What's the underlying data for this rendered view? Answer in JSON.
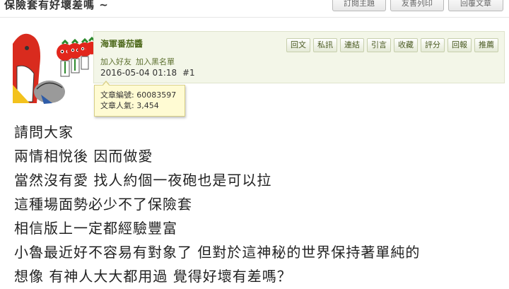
{
  "topic": {
    "title": "保險套有好壞差嗎 ~"
  },
  "toolbar": {
    "subscribe": "訂閱主題",
    "print": "友善列印",
    "reply": "回覆文章"
  },
  "post": {
    "author": "海軍番茄醬",
    "add_friend": "加入好友",
    "add_blacklist": "加入黑名單",
    "datetime": "2016-05-04 01:18",
    "floor": "#1",
    "actions": [
      "回文",
      "私訊",
      "連結",
      "引言",
      "收藏",
      "評分",
      "回報",
      "推薦"
    ],
    "article_id_label": "文章編號:",
    "article_id": "60083597",
    "popularity_label": "文章人氣:",
    "popularity": "3,454",
    "lines": [
      "請問大家",
      "兩情相悅後 因而做愛",
      "當然沒有愛 找人約個一夜砲也是可以拉",
      "這種場面勢必少不了保險套",
      "相信版上一定都經驗豐富",
      "小魯最近好不容易有對象了 但對於這神秘的世界保持著單純的",
      "想像 有神人大大都用過 覺得好壞有差嗎？"
    ]
  },
  "colors": {
    "header_bg": "#f3f6e8",
    "accent_green": "#4f6a1d",
    "tooltip_bg": "#fffbd3"
  }
}
